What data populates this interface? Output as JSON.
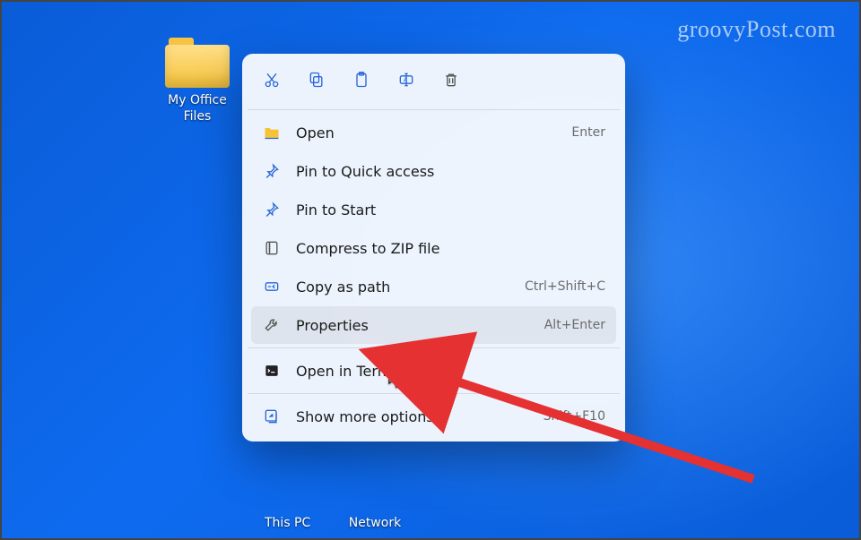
{
  "watermark": "groovyPost.com",
  "desktop": {
    "folder_label": "My Office\nFiles",
    "under_labels": [
      "This PC",
      "Network"
    ]
  },
  "context_menu": {
    "top_actions": [
      {
        "name": "cut-icon"
      },
      {
        "name": "copy-icon"
      },
      {
        "name": "paste-icon"
      },
      {
        "name": "rename-icon"
      },
      {
        "name": "delete-icon"
      }
    ],
    "items": [
      {
        "icon": "folder-open-icon",
        "label": "Open",
        "shortcut": "Enter"
      },
      {
        "icon": "pin-icon",
        "label": "Pin to Quick access",
        "shortcut": ""
      },
      {
        "icon": "pin-icon",
        "label": "Pin to Start",
        "shortcut": ""
      },
      {
        "icon": "zip-icon",
        "label": "Compress to ZIP file",
        "shortcut": ""
      },
      {
        "icon": "path-icon",
        "label": "Copy as path",
        "shortcut": "Ctrl+Shift+C"
      },
      {
        "icon": "wrench-icon",
        "label": "Properties",
        "shortcut": "Alt+Enter",
        "hover": true
      }
    ],
    "terminal": {
      "icon": "terminal-icon",
      "label": "Open in Terminal",
      "shortcut": ""
    },
    "more": {
      "icon": "more-icon",
      "label": "Show more options",
      "shortcut": "Shift+F10"
    }
  }
}
